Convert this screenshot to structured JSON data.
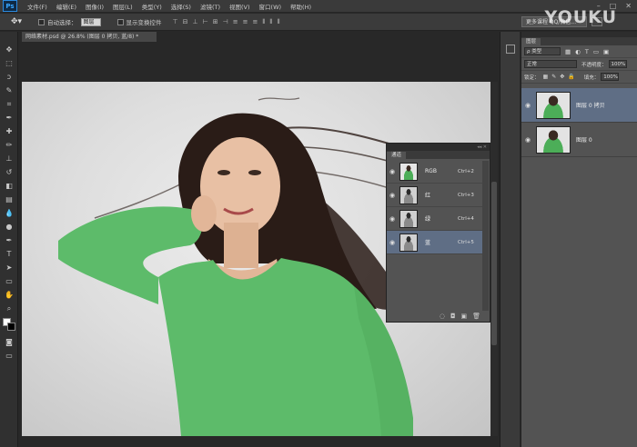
{
  "app": {
    "logo": "Ps"
  },
  "menu": [
    "文件(F)",
    "编辑(E)",
    "图像(I)",
    "图层(L)",
    "类型(Y)",
    "选择(S)",
    "滤镜(T)",
    "视图(V)",
    "窗口(W)",
    "帮助(H)"
  ],
  "options": {
    "auto_select_label": "自动选择：",
    "auto_select_value": "图层",
    "show_transform_label": "显示变换控件",
    "course_text": "更多课程 QQ/微信..."
  },
  "watermark": "YOUKU",
  "document": {
    "tab_title": "网络素材.psd @ 26.8% (图层 0 拷贝, 蓝/8) *"
  },
  "channels_panel": {
    "tab": "通道",
    "channels": [
      {
        "name": "RGB",
        "shortcut": "Ctrl+2"
      },
      {
        "name": "红",
        "shortcut": "Ctrl+3"
      },
      {
        "name": "绿",
        "shortcut": "Ctrl+4"
      },
      {
        "name": "蓝",
        "shortcut": "Ctrl+5"
      }
    ]
  },
  "layers_panel": {
    "tab": "图层",
    "filter_label": "ρ 类型",
    "blend_mode": "正常",
    "opacity_label": "不透明度：",
    "opacity": "100%",
    "lock_label": "锁定：",
    "fill_label": "填充：",
    "fill": "100%",
    "layers": [
      {
        "name": "图层 0 拷贝"
      },
      {
        "name": "图层 0"
      }
    ]
  },
  "colors": {
    "selection": "#5f6e85",
    "shirt": "#5dbb6a",
    "hair": "#2a1c17"
  }
}
